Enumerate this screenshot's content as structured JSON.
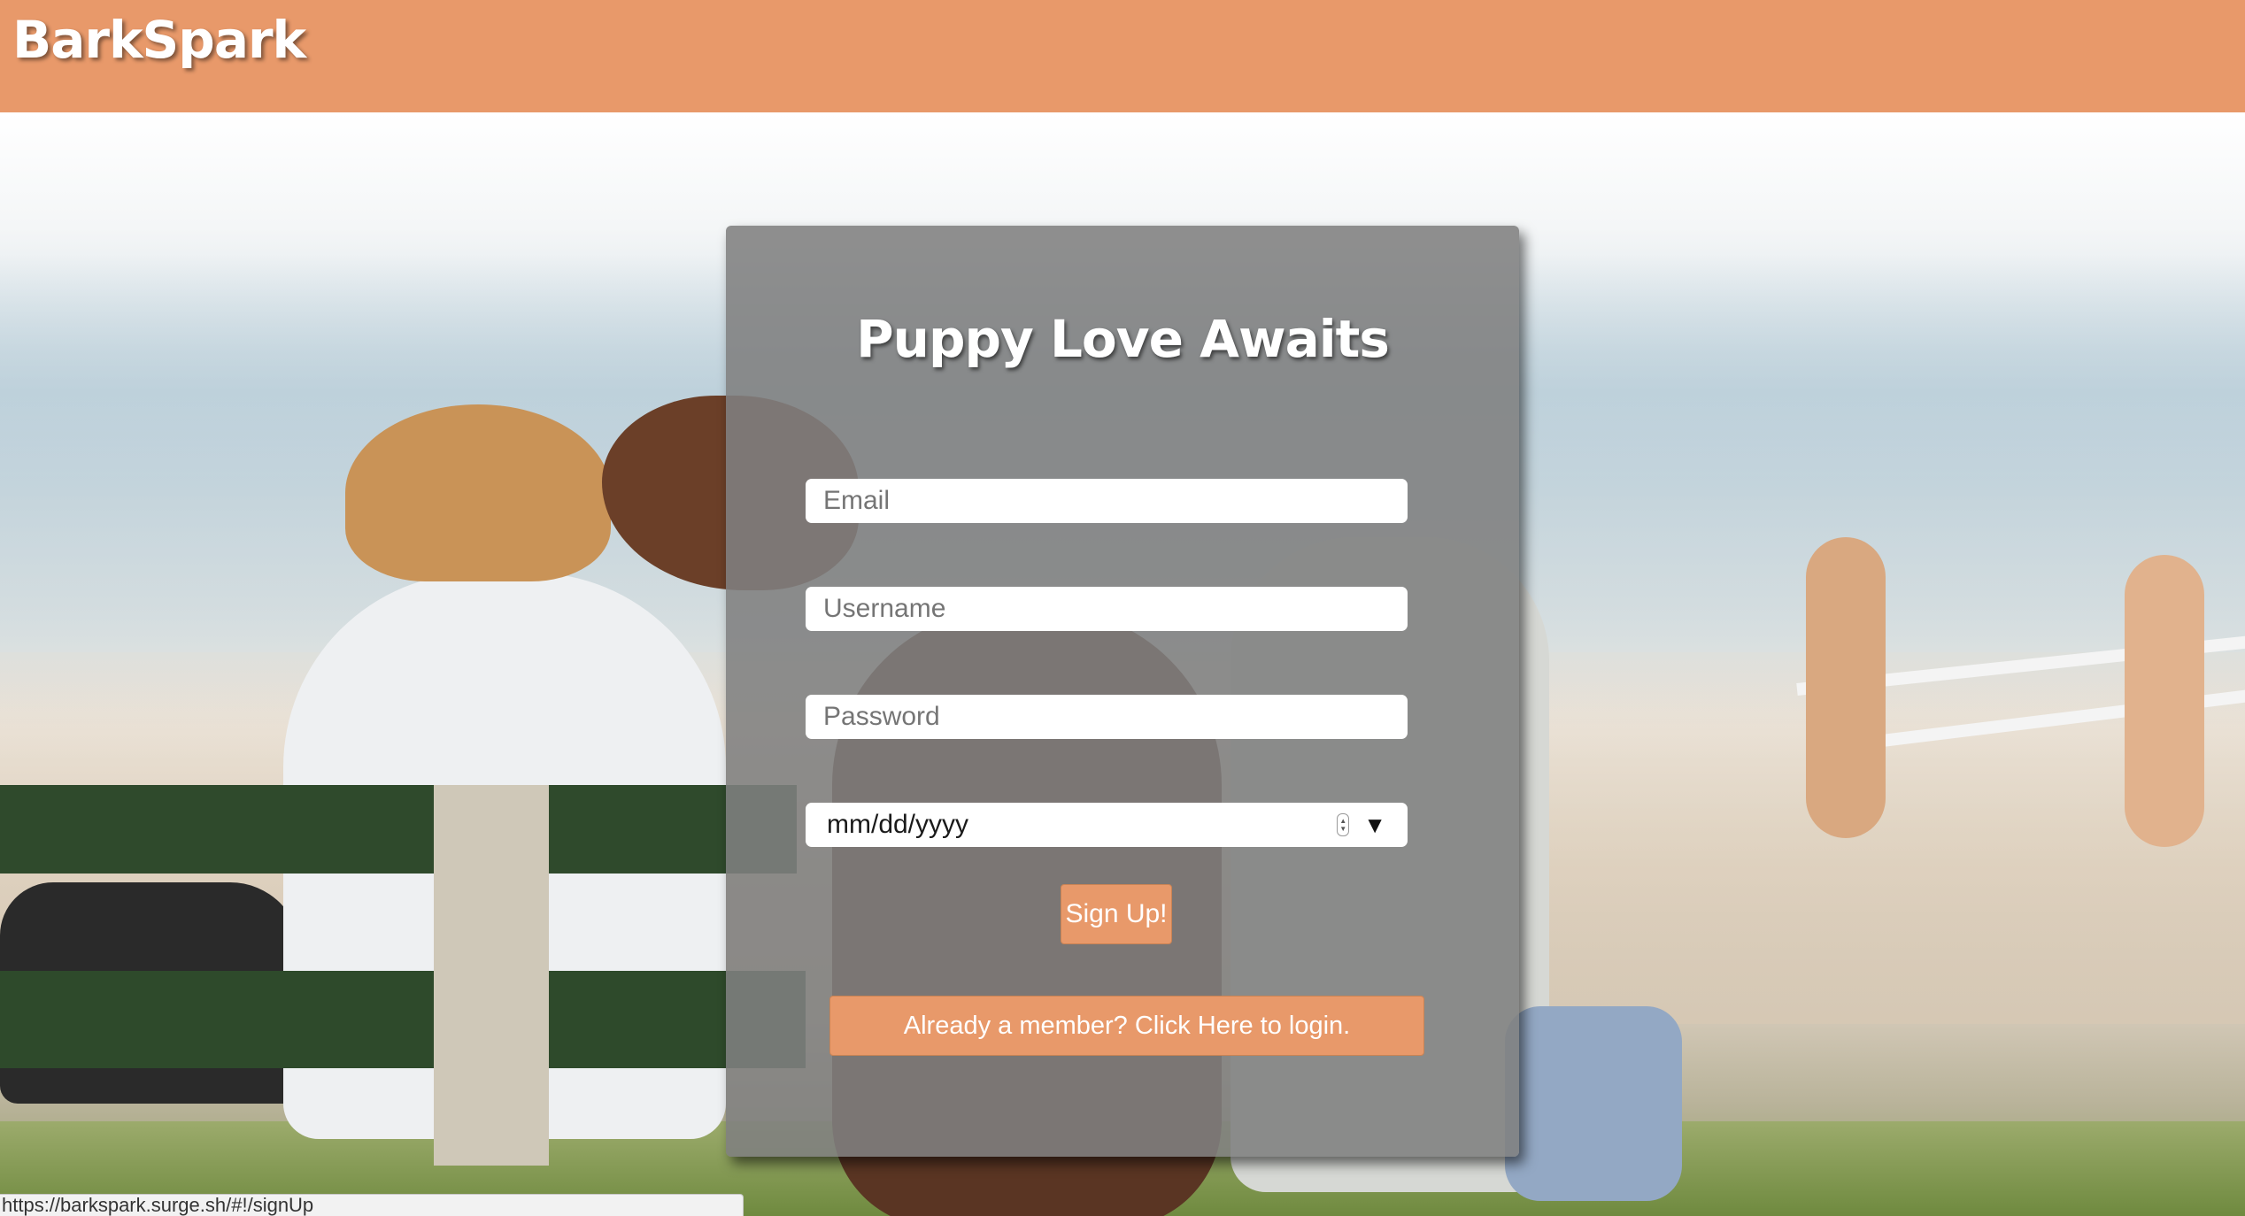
{
  "header": {
    "brand": "BarkSpark"
  },
  "form": {
    "title": "Puppy Love Awaits",
    "email_placeholder": "Email",
    "username_placeholder": "Username",
    "password_placeholder": "Password",
    "birthdate_placeholder": "mm/dd/yyyy",
    "signup_label": "Sign Up!",
    "login_prefix": "Already a member? Click ",
    "login_link": "Here",
    "login_suffix": " to login."
  },
  "icons": {
    "date_spinner": "spinner-icon",
    "date_dropdown": "dropdown-arrow-icon"
  },
  "colors": {
    "brand": "#e8996a",
    "card_overlay": "#808080"
  },
  "status_bar": {
    "url": "https://barkspark.surge.sh/#!/signUp"
  }
}
